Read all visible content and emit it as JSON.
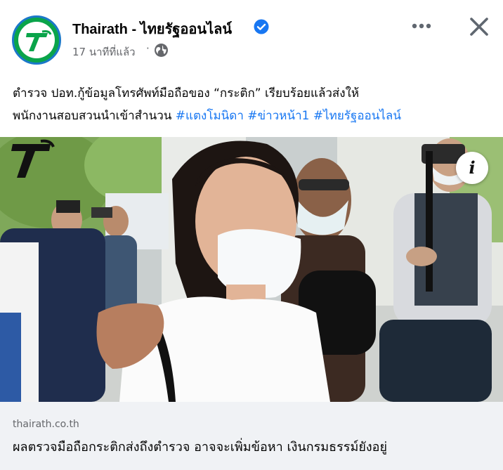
{
  "post": {
    "page_name": "Thairath - ไทยรัฐออนไลน์",
    "timestamp": "17 นาทีที่แล้ว",
    "separator": "·",
    "caption": {
      "line1": "ตำรวจ ปอท.กู้ข้อมูลโทรศัพท์มือถือของ “กระติก” เรียบร้อยแล้วส่งให้",
      "line2": "พนักงานสอบสวนนำเข้าสำนวน",
      "hashtags": [
        "#แตงโมนิดา",
        "#ข่าวหน้า1",
        "#ไทยรัฐออนไลน์"
      ]
    },
    "info_button": "i",
    "link": {
      "domain": "thairath.co.th",
      "title": "ผลตรวจมือถือกระติกส่งถึงตำรวจ อาจจะเพิ่มข้อหา เงินกรมธรรม์ยังอยู่"
    }
  },
  "icons": {
    "avatar": "thairath-logo-icon",
    "verified": "verified-badge-icon",
    "privacy": "globe-icon",
    "more": "more-options-icon",
    "close": "close-icon"
  },
  "colors": {
    "hashtag": "#1877f2",
    "verified": "#1877f2",
    "brand_green": "#0aa44a",
    "link_card_bg": "#f0f2f5",
    "secondary_text": "#65676b"
  }
}
